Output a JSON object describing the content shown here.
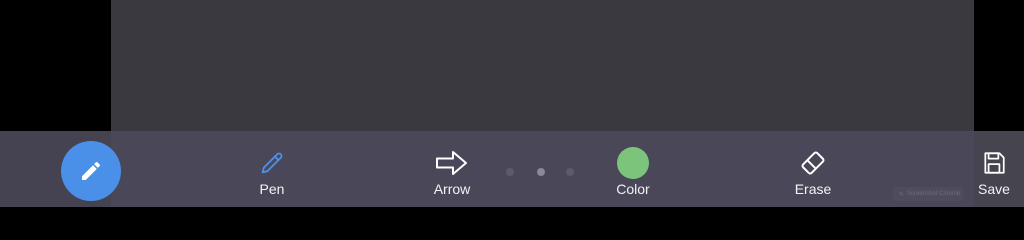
{
  "colors": {
    "fab": "#4a90e8",
    "pen_icon": "#4a90e8",
    "selected_color": "#7cc47c",
    "label_text": "#f2f2f5",
    "toolbar_bg": "#4a4858",
    "canvas_bg": "#3a3940"
  },
  "fab": {
    "icon": "pencil-icon"
  },
  "tools": {
    "pen": {
      "label": "Pen",
      "icon": "pen-icon"
    },
    "arrow": {
      "label": "Arrow",
      "icon": "arrow-right-icon"
    },
    "color": {
      "label": "Color",
      "icon": "color-swatch"
    },
    "erase": {
      "label": "Erase",
      "icon": "eraser-icon"
    },
    "save": {
      "label": "Save",
      "icon": "floppy-disk-icon"
    }
  },
  "pager": {
    "count": 3,
    "active_index": 1
  },
  "watermark": {
    "text": "Screenshot Chrome"
  }
}
